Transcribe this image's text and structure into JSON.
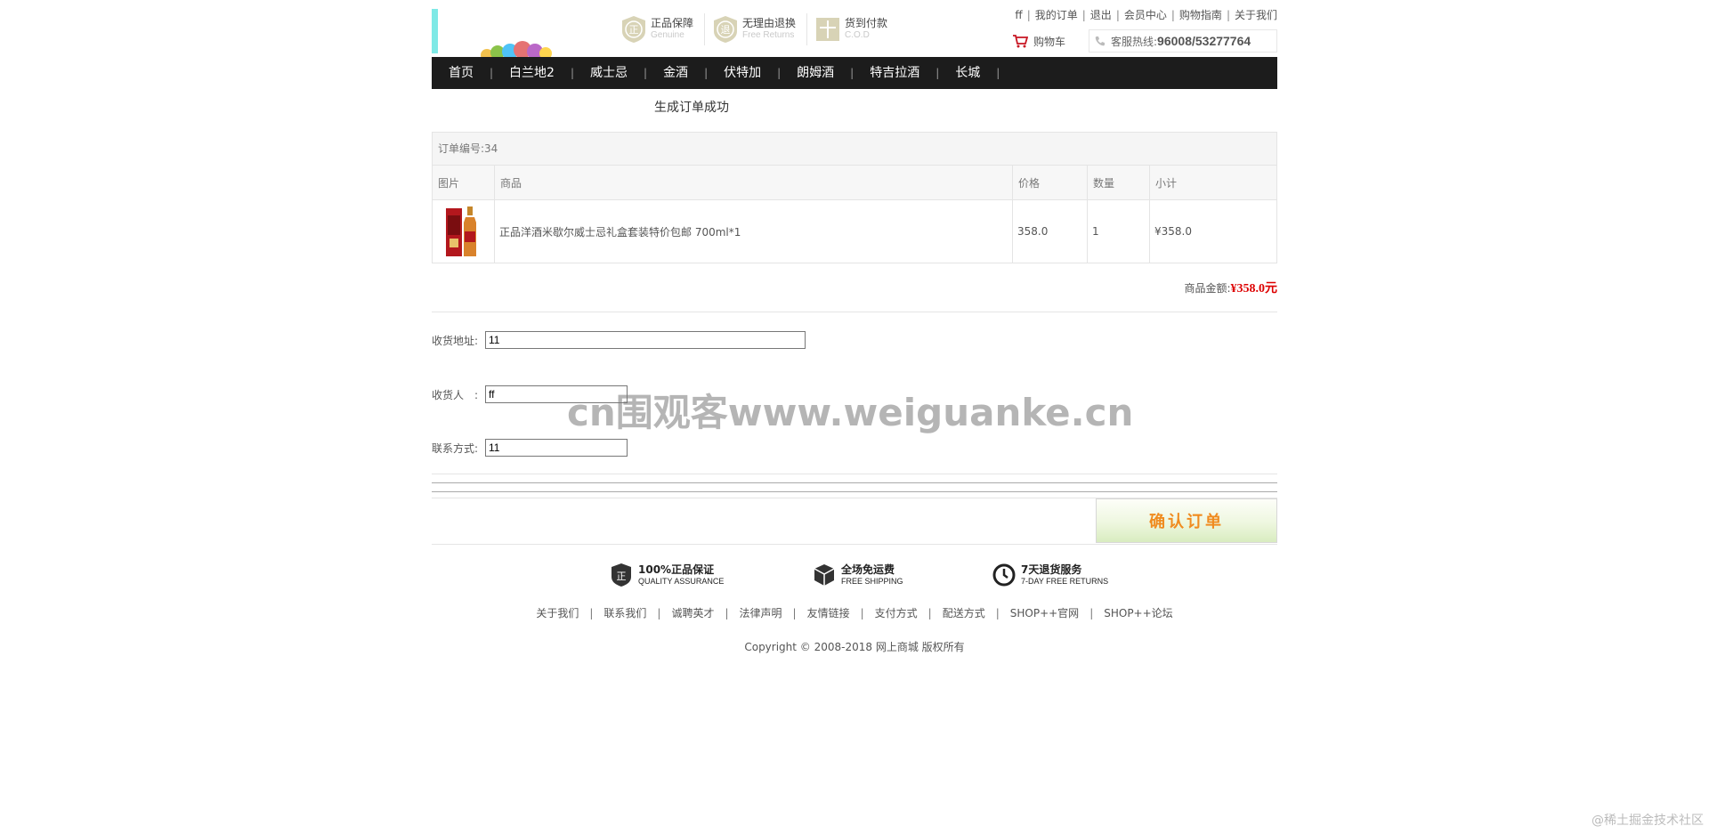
{
  "header": {
    "badges": [
      {
        "title": "正品保障",
        "sub": "Genuine",
        "icon": "genuine-icon"
      },
      {
        "title": "无理由退换",
        "sub": "Free Returns",
        "icon": "returns-icon"
      },
      {
        "title": "货到付款",
        "sub": "C.O.D",
        "icon": "cod-icon"
      }
    ],
    "toplinks": [
      "ff",
      "我的订单",
      "退出",
      "会员中心",
      "购物指南",
      "关于我们"
    ],
    "cart_label": "购物车",
    "hotline_label": "客服热线:",
    "hotline_number": "96008/53277764"
  },
  "nav": [
    "首页",
    "白兰地2",
    "威士忌",
    "金酒",
    "伏特加",
    "朗姆酒",
    "特吉拉酒",
    "长城"
  ],
  "success_message": "生成订单成功",
  "order": {
    "caption": "订单编号:34",
    "columns": [
      "图片",
      "商品",
      "价格",
      "数量",
      "小计"
    ],
    "items": [
      {
        "name": "正品洋酒米歇尔威士忌礼盒套装特价包邮 700ml*1",
        "price": "358.0",
        "qty": "1",
        "subtotal": "¥358.0"
      }
    ],
    "total_label": "商品金额:",
    "total_value": "¥358.0元"
  },
  "form": {
    "address_label": "收货地址:",
    "address_value": "11",
    "receiver_label": "收货人　:",
    "receiver_value": "ff",
    "phone_label": "联系方式:",
    "phone_value": "11"
  },
  "confirm_label": "确认订单",
  "footer": {
    "services": [
      {
        "title": "100%正品保证",
        "sub": "QUALITY ASSURANCE",
        "icon": "quality-shield-icon"
      },
      {
        "title": "全场免运费",
        "sub": "FREE SHIPPING",
        "icon": "box-icon"
      },
      {
        "title": "7天退货服务",
        "sub": "7-DAY FREE RETURNS",
        "icon": "clock-icon"
      }
    ],
    "links": [
      "关于我们",
      "联系我们",
      "诚聘英才",
      "法律声明",
      "友情链接",
      "支付方式",
      "配送方式",
      "SHOP++官网",
      "SHOP++论坛"
    ],
    "copyright": "Copyright © 2008-2018 网上商城 版权所有"
  },
  "watermark": "cn围观客www.weiguanke.cn",
  "corner_watermark": "@稀土掘金技术社区",
  "colors": {
    "nav_bg": "#1c1c1c",
    "total": "#dd0000",
    "confirm_text": "#f08b1f"
  }
}
